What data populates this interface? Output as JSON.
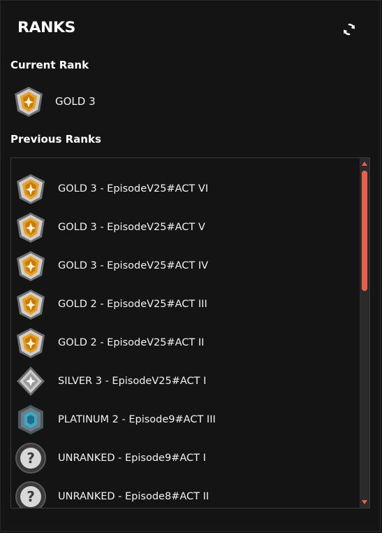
{
  "header": {
    "title": "RANKS",
    "refresh_icon": "refresh-icon"
  },
  "current_section": {
    "label": "Current Rank",
    "rank": {
      "text": "GOLD 3",
      "icon": "gold-rank-icon"
    }
  },
  "previous_section": {
    "label": "Previous Ranks",
    "items": [
      {
        "text": "GOLD 3 - EpisodeV25#ACT VI",
        "icon": "gold-rank-icon"
      },
      {
        "text": "GOLD 3 - EpisodeV25#ACT V",
        "icon": "gold-rank-icon"
      },
      {
        "text": "GOLD 3 - EpisodeV25#ACT IV",
        "icon": "gold-rank-icon"
      },
      {
        "text": "GOLD 2 - EpisodeV25#ACT III",
        "icon": "gold-rank-icon"
      },
      {
        "text": "GOLD 2 - EpisodeV25#ACT II",
        "icon": "gold-rank-icon"
      },
      {
        "text": "SILVER 3 - EpisodeV25#ACT I",
        "icon": "silver-rank-icon"
      },
      {
        "text": "PLATINUM 2 - Episode9#ACT III",
        "icon": "platinum-rank-icon"
      },
      {
        "text": "UNRANKED - Episode9#ACT I",
        "icon": "unranked-icon"
      },
      {
        "text": "UNRANKED - Episode8#ACT II",
        "icon": "unranked-icon"
      }
    ]
  },
  "colors": {
    "background": "#141414",
    "accent": "#e8604c",
    "gold": "#e8a020",
    "silver": "#c8c8c8",
    "platinum": "#3aa8c8"
  }
}
